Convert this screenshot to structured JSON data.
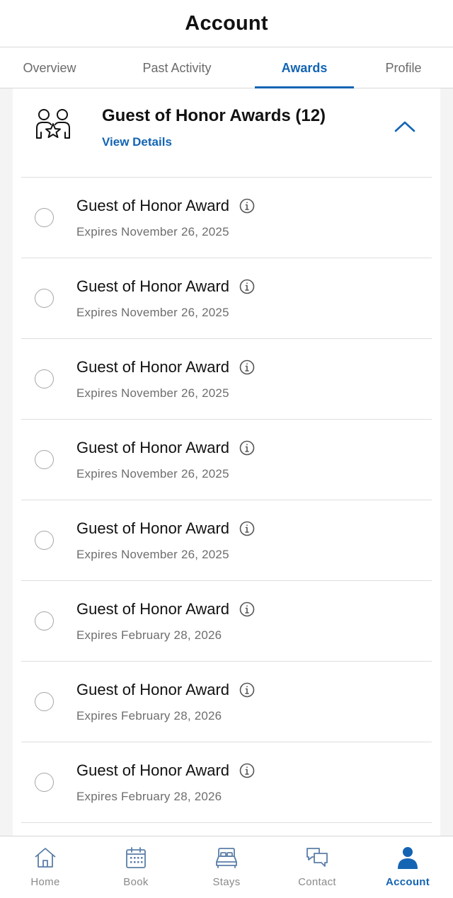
{
  "header": {
    "title": "Account"
  },
  "tabs": [
    {
      "label": "Overview",
      "active": false
    },
    {
      "label": "Past Activity",
      "active": false
    },
    {
      "label": "Awards",
      "active": true
    },
    {
      "label": "Profile",
      "active": false
    }
  ],
  "award_group": {
    "title": "Guest of Honor Awards (12)",
    "link": "View Details",
    "icon": "guests-star-icon",
    "collapse_icon": "chevron-up-icon"
  },
  "awards": [
    {
      "title": "Guest of Honor Award",
      "expiry": "Expires November 26, 2025"
    },
    {
      "title": "Guest of Honor Award",
      "expiry": "Expires November 26, 2025"
    },
    {
      "title": "Guest of Honor Award",
      "expiry": "Expires November 26, 2025"
    },
    {
      "title": "Guest of Honor Award",
      "expiry": "Expires November 26, 2025"
    },
    {
      "title": "Guest of Honor Award",
      "expiry": "Expires November 26, 2025"
    },
    {
      "title": "Guest of Honor Award",
      "expiry": "Expires February 28, 2026"
    },
    {
      "title": "Guest of Honor Award",
      "expiry": "Expires February 28, 2026"
    },
    {
      "title": "Guest of Honor Award",
      "expiry": "Expires February 28, 2026"
    },
    {
      "title": "",
      "expiry": ""
    }
  ],
  "bottom_nav": [
    {
      "label": "Home",
      "icon": "home-icon",
      "active": false
    },
    {
      "label": "Book",
      "icon": "calendar-icon",
      "active": false
    },
    {
      "label": "Stays",
      "icon": "bed-icon",
      "active": false
    },
    {
      "label": "Contact",
      "icon": "chat-bubbles-icon",
      "active": false
    },
    {
      "label": "Account",
      "icon": "person-icon",
      "active": true
    }
  ],
  "colors": {
    "accent": "#1464b4",
    "muted": "#6e6e6e",
    "divider": "#dedede"
  }
}
